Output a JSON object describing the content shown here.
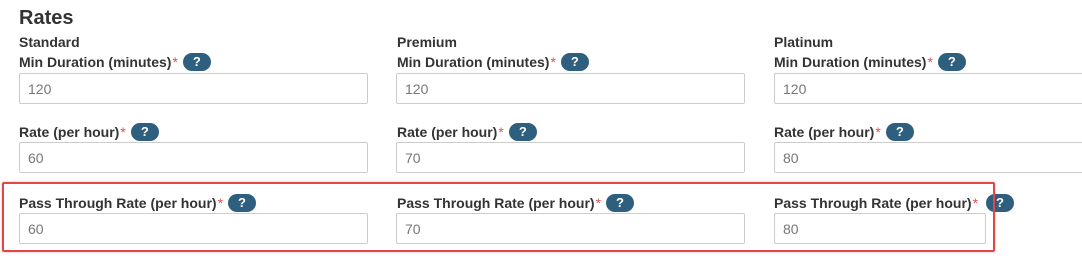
{
  "section": {
    "title": "Rates"
  },
  "columns": [
    {
      "name": "Standard",
      "min_duration": {
        "label": "Min Duration (minutes)",
        "value": "120"
      },
      "rate": {
        "label": "Rate (per hour)",
        "value": "60"
      },
      "pass_through": {
        "label": "Pass Through Rate (per hour)",
        "value": "60"
      }
    },
    {
      "name": "Premium",
      "min_duration": {
        "label": "Min Duration (minutes)",
        "value": "120"
      },
      "rate": {
        "label": "Rate (per hour)",
        "value": "70"
      },
      "pass_through": {
        "label": "Pass Through Rate (per hour)",
        "value": "70"
      }
    },
    {
      "name": "Platinum",
      "min_duration": {
        "label": "Min Duration (minutes)",
        "value": "120"
      },
      "rate": {
        "label": "Rate (per hour)",
        "value": "80"
      },
      "pass_through": {
        "label": "Pass Through Rate (per hour)",
        "value": "80"
      }
    }
  ],
  "required_marker": "*",
  "help_glyph": "?",
  "colors": {
    "help_badge": "#2f5f7f",
    "required": "#d9534f",
    "highlight": "#e04848"
  }
}
